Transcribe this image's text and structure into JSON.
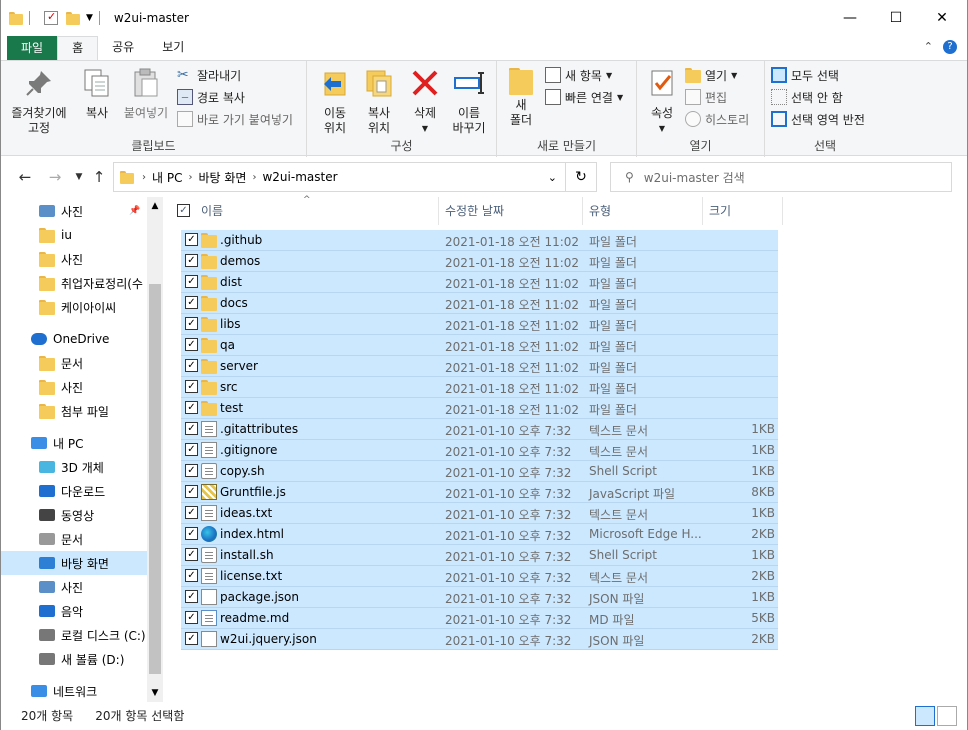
{
  "window": {
    "title": "w2ui-master",
    "minimize": "—",
    "maximize": "☐",
    "close": "✕"
  },
  "ribbon_tabs": [
    "파일",
    "홈",
    "공유",
    "보기"
  ],
  "ribbon_help": {
    "collapse": "⌃",
    "help": "?"
  },
  "ribbon": {
    "clipboard": {
      "label": "클립보드",
      "pin": "즐겨찾기에\n고정",
      "copy": "복사",
      "paste": "붙여넣기",
      "cut": "잘라내기",
      "copy_path": "경로 복사",
      "paste_shortcut": "바로 가기 붙여넣기"
    },
    "organize": {
      "label": "구성",
      "move_to": "이동\n위치",
      "copy_to": "복사\n위치",
      "delete": "삭제",
      "rename": "이름\n바꾸기"
    },
    "new": {
      "label": "새로 만들기",
      "new_folder": "새\n폴더",
      "new_item": "새 항목",
      "easy_access": "빠른 연결"
    },
    "open": {
      "label": "열기",
      "properties": "속성",
      "open": "열기",
      "edit": "편집",
      "history": "히스토리"
    },
    "select": {
      "label": "선택",
      "select_all": "모두 선택",
      "select_none": "선택 안 함",
      "invert": "선택 영역 반전"
    }
  },
  "address": {
    "breadcrumbs": [
      "내 PC",
      "바탕 화면",
      "w2ui-master"
    ],
    "search_placeholder": "w2ui-master 검색"
  },
  "nav": [
    {
      "label": "사진",
      "icon": "pictures-icon",
      "pinned": true
    },
    {
      "label": "iu",
      "icon": "folder-icon"
    },
    {
      "label": "사진",
      "icon": "folder-icon"
    },
    {
      "label": "취업자료정리(수",
      "icon": "folder-icon"
    },
    {
      "label": "케이아이씨",
      "icon": "folder-icon"
    },
    {
      "label": "OneDrive",
      "icon": "cloud-icon",
      "root": true
    },
    {
      "label": "문서",
      "icon": "folder-icon"
    },
    {
      "label": "사진",
      "icon": "folder-icon"
    },
    {
      "label": "첨부 파일",
      "icon": "folder-icon"
    },
    {
      "label": "내 PC",
      "icon": "pc-icon",
      "root": true
    },
    {
      "label": "3D 개체",
      "icon": "cube-icon"
    },
    {
      "label": "다운로드",
      "icon": "download-icon"
    },
    {
      "label": "동영상",
      "icon": "video-icon"
    },
    {
      "label": "문서",
      "icon": "documents-icon"
    },
    {
      "label": "바탕 화면",
      "icon": "desktop-icon",
      "selected": true
    },
    {
      "label": "사진",
      "icon": "pictures-icon"
    },
    {
      "label": "음악",
      "icon": "music-icon"
    },
    {
      "label": "로컬 디스크 (C:)",
      "icon": "drive-icon"
    },
    {
      "label": "새 볼륨 (D:)",
      "icon": "drive-icon"
    },
    {
      "label": "네트워크",
      "icon": "network-icon",
      "root": true
    }
  ],
  "columns": [
    "이름",
    "수정한 날짜",
    "유형",
    "크기"
  ],
  "files": [
    {
      "name": ".github",
      "date": "2021-01-18 오전 11:02",
      "type": "파일 폴더",
      "size": "",
      "icon": "folder-icon"
    },
    {
      "name": "demos",
      "date": "2021-01-18 오전 11:02",
      "type": "파일 폴더",
      "size": "",
      "icon": "folder-icon"
    },
    {
      "name": "dist",
      "date": "2021-01-18 오전 11:02",
      "type": "파일 폴더",
      "size": "",
      "icon": "folder-icon"
    },
    {
      "name": "docs",
      "date": "2021-01-18 오전 11:02",
      "type": "파일 폴더",
      "size": "",
      "icon": "folder-icon"
    },
    {
      "name": "libs",
      "date": "2021-01-18 오전 11:02",
      "type": "파일 폴더",
      "size": "",
      "icon": "folder-icon"
    },
    {
      "name": "qa",
      "date": "2021-01-18 오전 11:02",
      "type": "파일 폴더",
      "size": "",
      "icon": "folder-icon"
    },
    {
      "name": "server",
      "date": "2021-01-18 오전 11:02",
      "type": "파일 폴더",
      "size": "",
      "icon": "folder-icon"
    },
    {
      "name": "src",
      "date": "2021-01-18 오전 11:02",
      "type": "파일 폴더",
      "size": "",
      "icon": "folder-icon"
    },
    {
      "name": "test",
      "date": "2021-01-18 오전 11:02",
      "type": "파일 폴더",
      "size": "",
      "icon": "folder-icon"
    },
    {
      "name": ".gitattributes",
      "date": "2021-01-10 오후 7:32",
      "type": "텍스트 문서",
      "size": "1KB",
      "icon": "text-file-icon"
    },
    {
      "name": ".gitignore",
      "date": "2021-01-10 오후 7:32",
      "type": "텍스트 문서",
      "size": "1KB",
      "icon": "text-file-icon"
    },
    {
      "name": "copy.sh",
      "date": "2021-01-10 오후 7:32",
      "type": "Shell Script",
      "size": "1KB",
      "icon": "script-file-icon"
    },
    {
      "name": "Gruntfile.js",
      "date": "2021-01-10 오후 7:32",
      "type": "JavaScript 파일",
      "size": "8KB",
      "icon": "js-file-icon"
    },
    {
      "name": "ideas.txt",
      "date": "2021-01-10 오후 7:32",
      "type": "텍스트 문서",
      "size": "1KB",
      "icon": "text-file-icon"
    },
    {
      "name": "index.html",
      "date": "2021-01-10 오후 7:32",
      "type": "Microsoft Edge H...",
      "size": "2KB",
      "icon": "edge-icon"
    },
    {
      "name": "install.sh",
      "date": "2021-01-10 오후 7:32",
      "type": "Shell Script",
      "size": "1KB",
      "icon": "script-file-icon"
    },
    {
      "name": "license.txt",
      "date": "2021-01-10 오후 7:32",
      "type": "텍스트 문서",
      "size": "2KB",
      "icon": "text-file-icon"
    },
    {
      "name": "package.json",
      "date": "2021-01-10 오후 7:32",
      "type": "JSON 파일",
      "size": "1KB",
      "icon": "blank-file-icon"
    },
    {
      "name": "readme.md",
      "date": "2021-01-10 오후 7:32",
      "type": "MD 파일",
      "size": "5KB",
      "icon": "md-file-icon"
    },
    {
      "name": "w2ui.jquery.json",
      "date": "2021-01-10 오후 7:32",
      "type": "JSON 파일",
      "size": "2KB",
      "icon": "blank-file-icon"
    }
  ],
  "status": {
    "count": "20개 항목",
    "selected": "20개 항목 선택함"
  },
  "colors": {
    "selection": "#cce8ff",
    "file_tab": "#19794b",
    "folder": "#f5cc5c",
    "accent": "#0078d7"
  }
}
